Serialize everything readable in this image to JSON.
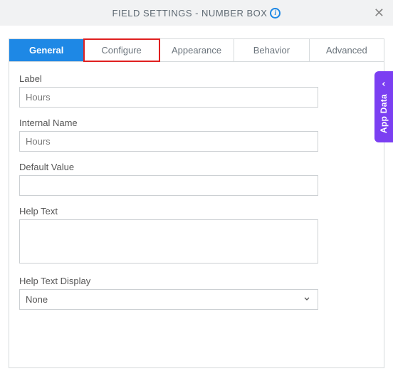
{
  "header": {
    "title": "FIELD SETTINGS - NUMBER BOX"
  },
  "tabs": [
    {
      "label": "General",
      "active": true,
      "highlight": false
    },
    {
      "label": "Configure",
      "active": false,
      "highlight": true
    },
    {
      "label": "Appearance",
      "active": false,
      "highlight": false
    },
    {
      "label": "Behavior",
      "active": false,
      "highlight": false
    },
    {
      "label": "Advanced",
      "active": false,
      "highlight": false
    }
  ],
  "fields": {
    "label": {
      "caption": "Label",
      "value": "Hours"
    },
    "internalName": {
      "caption": "Internal Name",
      "value": "Hours"
    },
    "defaultValue": {
      "caption": "Default Value",
      "value": ""
    },
    "helpText": {
      "caption": "Help Text",
      "value": ""
    },
    "helpTextDisplay": {
      "caption": "Help Text Display",
      "value": "None"
    }
  },
  "sideTab": {
    "label": "App Data"
  }
}
